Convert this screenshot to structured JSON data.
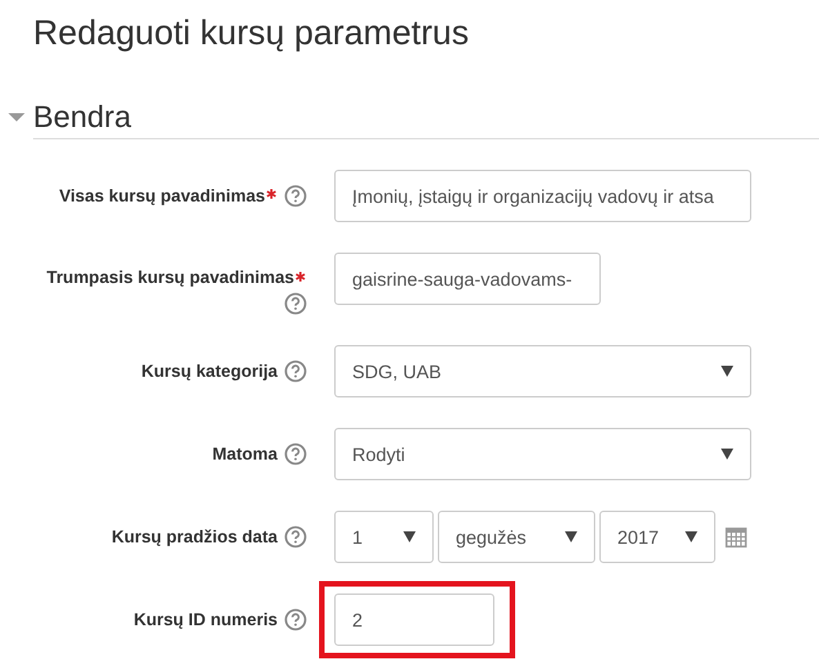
{
  "page_title": "Redaguoti kursų parametrus",
  "section": {
    "title": "Bendra",
    "expanded": true
  },
  "fields": [
    {
      "kind": "text",
      "label": "Visas kursų pavadinimas",
      "required": true,
      "value": "Įmonių, įstaigų ir organizacijų vadovų ir atsa",
      "highlighted": false
    },
    {
      "kind": "text",
      "label": "Trumpasis kursų pavadinimas",
      "required": true,
      "value": "gaisrine-sauga-vadovams-",
      "highlighted": false
    },
    {
      "kind": "select",
      "label": "Kursų kategorija",
      "required": false,
      "value": "SDG, UAB",
      "highlighted": false
    },
    {
      "kind": "select",
      "label": "Matoma",
      "required": false,
      "value": "Rodyti",
      "highlighted": false
    },
    {
      "kind": "date",
      "label": "Kursų pradžios data",
      "required": false,
      "parts": [
        "1",
        "gegužės",
        "2017"
      ],
      "highlighted": false
    },
    {
      "kind": "text",
      "label": "Kursų ID numeris",
      "required": false,
      "value": "2",
      "highlighted": true
    }
  ]
}
